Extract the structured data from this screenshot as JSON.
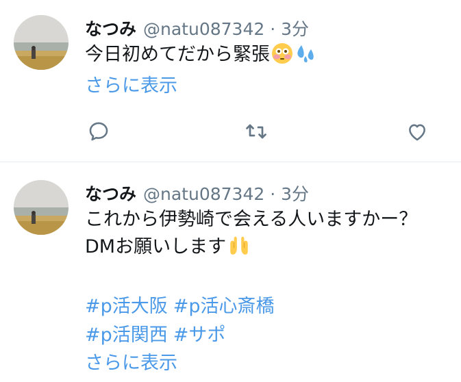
{
  "tweets": [
    {
      "name": "なつみ",
      "handle": "@natu087342",
      "separator": "·",
      "time": "3分",
      "text": "今日初めてだから緊張",
      "emojis": [
        "flushed-face",
        "sweat-droplets"
      ],
      "more_link": "さらに表示",
      "actions": [
        "reply",
        "retweet",
        "like"
      ]
    },
    {
      "name": "なつみ",
      "handle": "@natu087342",
      "separator": "·",
      "time": "3分",
      "text_line1": "これから伊勢崎で会える人いますかー？",
      "text_line2": "DMお願いします",
      "emojis": [
        "palms-up-together"
      ],
      "hashtags": [
        "#p活大阪",
        "#p活心斎橋",
        "#p活関西",
        "#サポ"
      ],
      "more_link": "さらに表示"
    }
  ],
  "colors": {
    "name": "#14171a",
    "muted": "#657786",
    "link": "#4a99e9",
    "divider": "#e6ecf0"
  }
}
